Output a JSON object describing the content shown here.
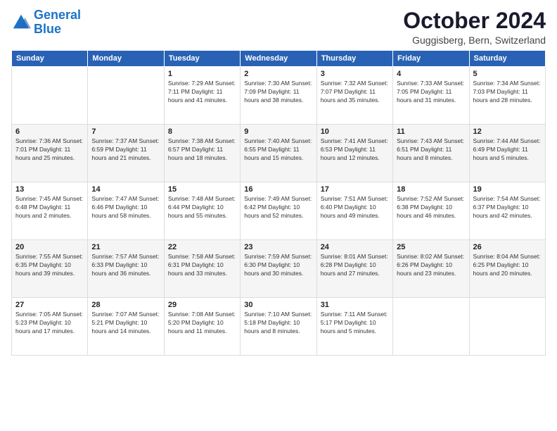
{
  "logo": {
    "line1": "General",
    "line2": "Blue"
  },
  "title": "October 2024",
  "subtitle": "Guggisberg, Bern, Switzerland",
  "weekdays": [
    "Sunday",
    "Monday",
    "Tuesday",
    "Wednesday",
    "Thursday",
    "Friday",
    "Saturday"
  ],
  "weeks": [
    [
      {
        "day": "",
        "info": ""
      },
      {
        "day": "",
        "info": ""
      },
      {
        "day": "1",
        "info": "Sunrise: 7:29 AM\nSunset: 7:11 PM\nDaylight: 11 hours and 41 minutes."
      },
      {
        "day": "2",
        "info": "Sunrise: 7:30 AM\nSunset: 7:09 PM\nDaylight: 11 hours and 38 minutes."
      },
      {
        "day": "3",
        "info": "Sunrise: 7:32 AM\nSunset: 7:07 PM\nDaylight: 11 hours and 35 minutes."
      },
      {
        "day": "4",
        "info": "Sunrise: 7:33 AM\nSunset: 7:05 PM\nDaylight: 11 hours and 31 minutes."
      },
      {
        "day": "5",
        "info": "Sunrise: 7:34 AM\nSunset: 7:03 PM\nDaylight: 11 hours and 28 minutes."
      }
    ],
    [
      {
        "day": "6",
        "info": "Sunrise: 7:36 AM\nSunset: 7:01 PM\nDaylight: 11 hours and 25 minutes."
      },
      {
        "day": "7",
        "info": "Sunrise: 7:37 AM\nSunset: 6:59 PM\nDaylight: 11 hours and 21 minutes."
      },
      {
        "day": "8",
        "info": "Sunrise: 7:38 AM\nSunset: 6:57 PM\nDaylight: 11 hours and 18 minutes."
      },
      {
        "day": "9",
        "info": "Sunrise: 7:40 AM\nSunset: 6:55 PM\nDaylight: 11 hours and 15 minutes."
      },
      {
        "day": "10",
        "info": "Sunrise: 7:41 AM\nSunset: 6:53 PM\nDaylight: 11 hours and 12 minutes."
      },
      {
        "day": "11",
        "info": "Sunrise: 7:43 AM\nSunset: 6:51 PM\nDaylight: 11 hours and 8 minutes."
      },
      {
        "day": "12",
        "info": "Sunrise: 7:44 AM\nSunset: 6:49 PM\nDaylight: 11 hours and 5 minutes."
      }
    ],
    [
      {
        "day": "13",
        "info": "Sunrise: 7:45 AM\nSunset: 6:48 PM\nDaylight: 11 hours and 2 minutes."
      },
      {
        "day": "14",
        "info": "Sunrise: 7:47 AM\nSunset: 6:46 PM\nDaylight: 10 hours and 58 minutes."
      },
      {
        "day": "15",
        "info": "Sunrise: 7:48 AM\nSunset: 6:44 PM\nDaylight: 10 hours and 55 minutes."
      },
      {
        "day": "16",
        "info": "Sunrise: 7:49 AM\nSunset: 6:42 PM\nDaylight: 10 hours and 52 minutes."
      },
      {
        "day": "17",
        "info": "Sunrise: 7:51 AM\nSunset: 6:40 PM\nDaylight: 10 hours and 49 minutes."
      },
      {
        "day": "18",
        "info": "Sunrise: 7:52 AM\nSunset: 6:38 PM\nDaylight: 10 hours and 46 minutes."
      },
      {
        "day": "19",
        "info": "Sunrise: 7:54 AM\nSunset: 6:37 PM\nDaylight: 10 hours and 42 minutes."
      }
    ],
    [
      {
        "day": "20",
        "info": "Sunrise: 7:55 AM\nSunset: 6:35 PM\nDaylight: 10 hours and 39 minutes."
      },
      {
        "day": "21",
        "info": "Sunrise: 7:57 AM\nSunset: 6:33 PM\nDaylight: 10 hours and 36 minutes."
      },
      {
        "day": "22",
        "info": "Sunrise: 7:58 AM\nSunset: 6:31 PM\nDaylight: 10 hours and 33 minutes."
      },
      {
        "day": "23",
        "info": "Sunrise: 7:59 AM\nSunset: 6:30 PM\nDaylight: 10 hours and 30 minutes."
      },
      {
        "day": "24",
        "info": "Sunrise: 8:01 AM\nSunset: 6:28 PM\nDaylight: 10 hours and 27 minutes."
      },
      {
        "day": "25",
        "info": "Sunrise: 8:02 AM\nSunset: 6:26 PM\nDaylight: 10 hours and 23 minutes."
      },
      {
        "day": "26",
        "info": "Sunrise: 8:04 AM\nSunset: 6:25 PM\nDaylight: 10 hours and 20 minutes."
      }
    ],
    [
      {
        "day": "27",
        "info": "Sunrise: 7:05 AM\nSunset: 5:23 PM\nDaylight: 10 hours and 17 minutes."
      },
      {
        "day": "28",
        "info": "Sunrise: 7:07 AM\nSunset: 5:21 PM\nDaylight: 10 hours and 14 minutes."
      },
      {
        "day": "29",
        "info": "Sunrise: 7:08 AM\nSunset: 5:20 PM\nDaylight: 10 hours and 11 minutes."
      },
      {
        "day": "30",
        "info": "Sunrise: 7:10 AM\nSunset: 5:18 PM\nDaylight: 10 hours and 8 minutes."
      },
      {
        "day": "31",
        "info": "Sunrise: 7:11 AM\nSunset: 5:17 PM\nDaylight: 10 hours and 5 minutes."
      },
      {
        "day": "",
        "info": ""
      },
      {
        "day": "",
        "info": ""
      }
    ]
  ]
}
